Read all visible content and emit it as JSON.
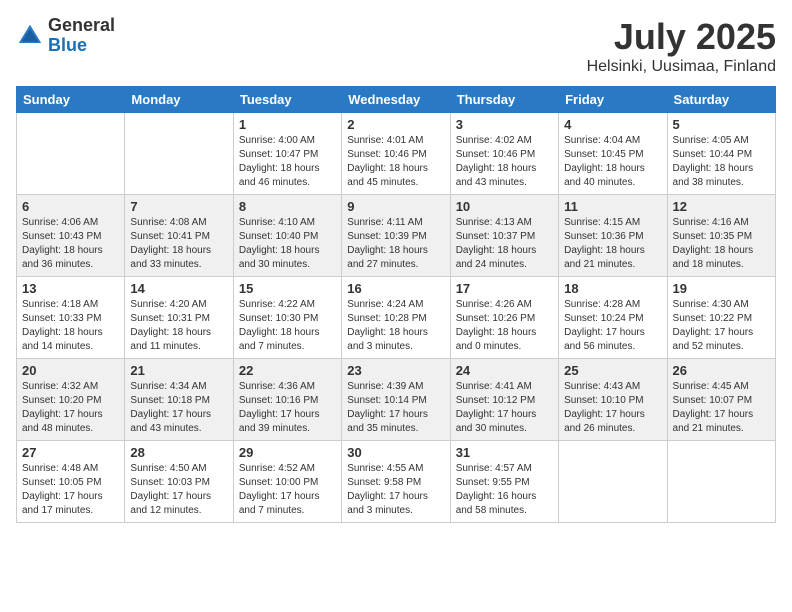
{
  "logo": {
    "general": "General",
    "blue": "Blue"
  },
  "title": {
    "month": "July 2025",
    "location": "Helsinki, Uusimaa, Finland"
  },
  "days_of_week": [
    "Sunday",
    "Monday",
    "Tuesday",
    "Wednesday",
    "Thursday",
    "Friday",
    "Saturday"
  ],
  "weeks": [
    [
      {
        "day": "",
        "sunrise": "",
        "sunset": "",
        "daylight": ""
      },
      {
        "day": "",
        "sunrise": "",
        "sunset": "",
        "daylight": ""
      },
      {
        "day": "1",
        "sunrise": "Sunrise: 4:00 AM",
        "sunset": "Sunset: 10:47 PM",
        "daylight": "Daylight: 18 hours and 46 minutes."
      },
      {
        "day": "2",
        "sunrise": "Sunrise: 4:01 AM",
        "sunset": "Sunset: 10:46 PM",
        "daylight": "Daylight: 18 hours and 45 minutes."
      },
      {
        "day": "3",
        "sunrise": "Sunrise: 4:02 AM",
        "sunset": "Sunset: 10:46 PM",
        "daylight": "Daylight: 18 hours and 43 minutes."
      },
      {
        "day": "4",
        "sunrise": "Sunrise: 4:04 AM",
        "sunset": "Sunset: 10:45 PM",
        "daylight": "Daylight: 18 hours and 40 minutes."
      },
      {
        "day": "5",
        "sunrise": "Sunrise: 4:05 AM",
        "sunset": "Sunset: 10:44 PM",
        "daylight": "Daylight: 18 hours and 38 minutes."
      }
    ],
    [
      {
        "day": "6",
        "sunrise": "Sunrise: 4:06 AM",
        "sunset": "Sunset: 10:43 PM",
        "daylight": "Daylight: 18 hours and 36 minutes."
      },
      {
        "day": "7",
        "sunrise": "Sunrise: 4:08 AM",
        "sunset": "Sunset: 10:41 PM",
        "daylight": "Daylight: 18 hours and 33 minutes."
      },
      {
        "day": "8",
        "sunrise": "Sunrise: 4:10 AM",
        "sunset": "Sunset: 10:40 PM",
        "daylight": "Daylight: 18 hours and 30 minutes."
      },
      {
        "day": "9",
        "sunrise": "Sunrise: 4:11 AM",
        "sunset": "Sunset: 10:39 PM",
        "daylight": "Daylight: 18 hours and 27 minutes."
      },
      {
        "day": "10",
        "sunrise": "Sunrise: 4:13 AM",
        "sunset": "Sunset: 10:37 PM",
        "daylight": "Daylight: 18 hours and 24 minutes."
      },
      {
        "day": "11",
        "sunrise": "Sunrise: 4:15 AM",
        "sunset": "Sunset: 10:36 PM",
        "daylight": "Daylight: 18 hours and 21 minutes."
      },
      {
        "day": "12",
        "sunrise": "Sunrise: 4:16 AM",
        "sunset": "Sunset: 10:35 PM",
        "daylight": "Daylight: 18 hours and 18 minutes."
      }
    ],
    [
      {
        "day": "13",
        "sunrise": "Sunrise: 4:18 AM",
        "sunset": "Sunset: 10:33 PM",
        "daylight": "Daylight: 18 hours and 14 minutes."
      },
      {
        "day": "14",
        "sunrise": "Sunrise: 4:20 AM",
        "sunset": "Sunset: 10:31 PM",
        "daylight": "Daylight: 18 hours and 11 minutes."
      },
      {
        "day": "15",
        "sunrise": "Sunrise: 4:22 AM",
        "sunset": "Sunset: 10:30 PM",
        "daylight": "Daylight: 18 hours and 7 minutes."
      },
      {
        "day": "16",
        "sunrise": "Sunrise: 4:24 AM",
        "sunset": "Sunset: 10:28 PM",
        "daylight": "Daylight: 18 hours and 3 minutes."
      },
      {
        "day": "17",
        "sunrise": "Sunrise: 4:26 AM",
        "sunset": "Sunset: 10:26 PM",
        "daylight": "Daylight: 18 hours and 0 minutes."
      },
      {
        "day": "18",
        "sunrise": "Sunrise: 4:28 AM",
        "sunset": "Sunset: 10:24 PM",
        "daylight": "Daylight: 17 hours and 56 minutes."
      },
      {
        "day": "19",
        "sunrise": "Sunrise: 4:30 AM",
        "sunset": "Sunset: 10:22 PM",
        "daylight": "Daylight: 17 hours and 52 minutes."
      }
    ],
    [
      {
        "day": "20",
        "sunrise": "Sunrise: 4:32 AM",
        "sunset": "Sunset: 10:20 PM",
        "daylight": "Daylight: 17 hours and 48 minutes."
      },
      {
        "day": "21",
        "sunrise": "Sunrise: 4:34 AM",
        "sunset": "Sunset: 10:18 PM",
        "daylight": "Daylight: 17 hours and 43 minutes."
      },
      {
        "day": "22",
        "sunrise": "Sunrise: 4:36 AM",
        "sunset": "Sunset: 10:16 PM",
        "daylight": "Daylight: 17 hours and 39 minutes."
      },
      {
        "day": "23",
        "sunrise": "Sunrise: 4:39 AM",
        "sunset": "Sunset: 10:14 PM",
        "daylight": "Daylight: 17 hours and 35 minutes."
      },
      {
        "day": "24",
        "sunrise": "Sunrise: 4:41 AM",
        "sunset": "Sunset: 10:12 PM",
        "daylight": "Daylight: 17 hours and 30 minutes."
      },
      {
        "day": "25",
        "sunrise": "Sunrise: 4:43 AM",
        "sunset": "Sunset: 10:10 PM",
        "daylight": "Daylight: 17 hours and 26 minutes."
      },
      {
        "day": "26",
        "sunrise": "Sunrise: 4:45 AM",
        "sunset": "Sunset: 10:07 PM",
        "daylight": "Daylight: 17 hours and 21 minutes."
      }
    ],
    [
      {
        "day": "27",
        "sunrise": "Sunrise: 4:48 AM",
        "sunset": "Sunset: 10:05 PM",
        "daylight": "Daylight: 17 hours and 17 minutes."
      },
      {
        "day": "28",
        "sunrise": "Sunrise: 4:50 AM",
        "sunset": "Sunset: 10:03 PM",
        "daylight": "Daylight: 17 hours and 12 minutes."
      },
      {
        "day": "29",
        "sunrise": "Sunrise: 4:52 AM",
        "sunset": "Sunset: 10:00 PM",
        "daylight": "Daylight: 17 hours and 7 minutes."
      },
      {
        "day": "30",
        "sunrise": "Sunrise: 4:55 AM",
        "sunset": "Sunset: 9:58 PM",
        "daylight": "Daylight: 17 hours and 3 minutes."
      },
      {
        "day": "31",
        "sunrise": "Sunrise: 4:57 AM",
        "sunset": "Sunset: 9:55 PM",
        "daylight": "Daylight: 16 hours and 58 minutes."
      },
      {
        "day": "",
        "sunrise": "",
        "sunset": "",
        "daylight": ""
      },
      {
        "day": "",
        "sunrise": "",
        "sunset": "",
        "daylight": ""
      }
    ]
  ]
}
